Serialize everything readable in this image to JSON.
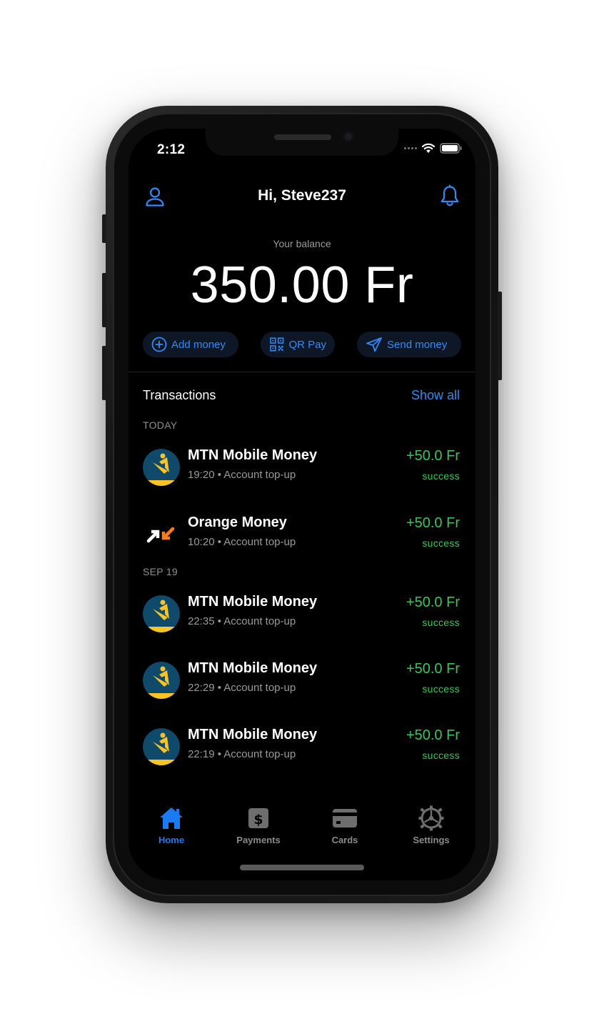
{
  "status_bar": {
    "time": "2:12"
  },
  "header": {
    "greeting": "Hi, Steve237"
  },
  "balance": {
    "label": "Your balance",
    "amount": "350.00 Fr"
  },
  "actions": {
    "add_money": "Add money",
    "qr_pay": "QR Pay",
    "send_money": "Send money"
  },
  "transactions": {
    "title": "Transactions",
    "show_all": "Show all",
    "groups": [
      {
        "label": "TODAY",
        "items": [
          {
            "name": "MTN Mobile Money",
            "meta": "19:20 • Account top-up",
            "amount": "+50.0 Fr",
            "status": "success",
            "provider": "mtn"
          },
          {
            "name": "Orange Money",
            "meta": "10:20 • Account top-up",
            "amount": "+50.0 Fr",
            "status": "success",
            "provider": "orange"
          }
        ]
      },
      {
        "label": "SEP 19",
        "items": [
          {
            "name": "MTN Mobile Money",
            "meta": "22:35 • Account top-up",
            "amount": "+50.0 Fr",
            "status": "success",
            "provider": "mtn"
          },
          {
            "name": "MTN Mobile Money",
            "meta": "22:29 • Account top-up",
            "amount": "+50.0 Fr",
            "status": "success",
            "provider": "mtn"
          },
          {
            "name": "MTN Mobile Money",
            "meta": "22:19 • Account top-up",
            "amount": "+50.0 Fr",
            "status": "success",
            "provider": "mtn"
          }
        ]
      }
    ]
  },
  "tabbar": {
    "home": "Home",
    "payments": "Payments",
    "cards": "Cards",
    "settings": "Settings"
  },
  "colors": {
    "accent": "#2f8bf5",
    "success": "#34c759",
    "background": "#000000",
    "mtn_blue": "#0f4a6b",
    "mtn_yellow": "#f7c325",
    "orange": "#ff7a1a"
  },
  "icons": {
    "user": "user-icon",
    "bell": "bell-icon",
    "add": "plus-circle-icon",
    "qr": "qr-code-icon",
    "send": "paper-plane-icon",
    "home": "home-icon",
    "payments": "dollar-icon",
    "cards": "card-icon",
    "settings": "gear-icon"
  }
}
